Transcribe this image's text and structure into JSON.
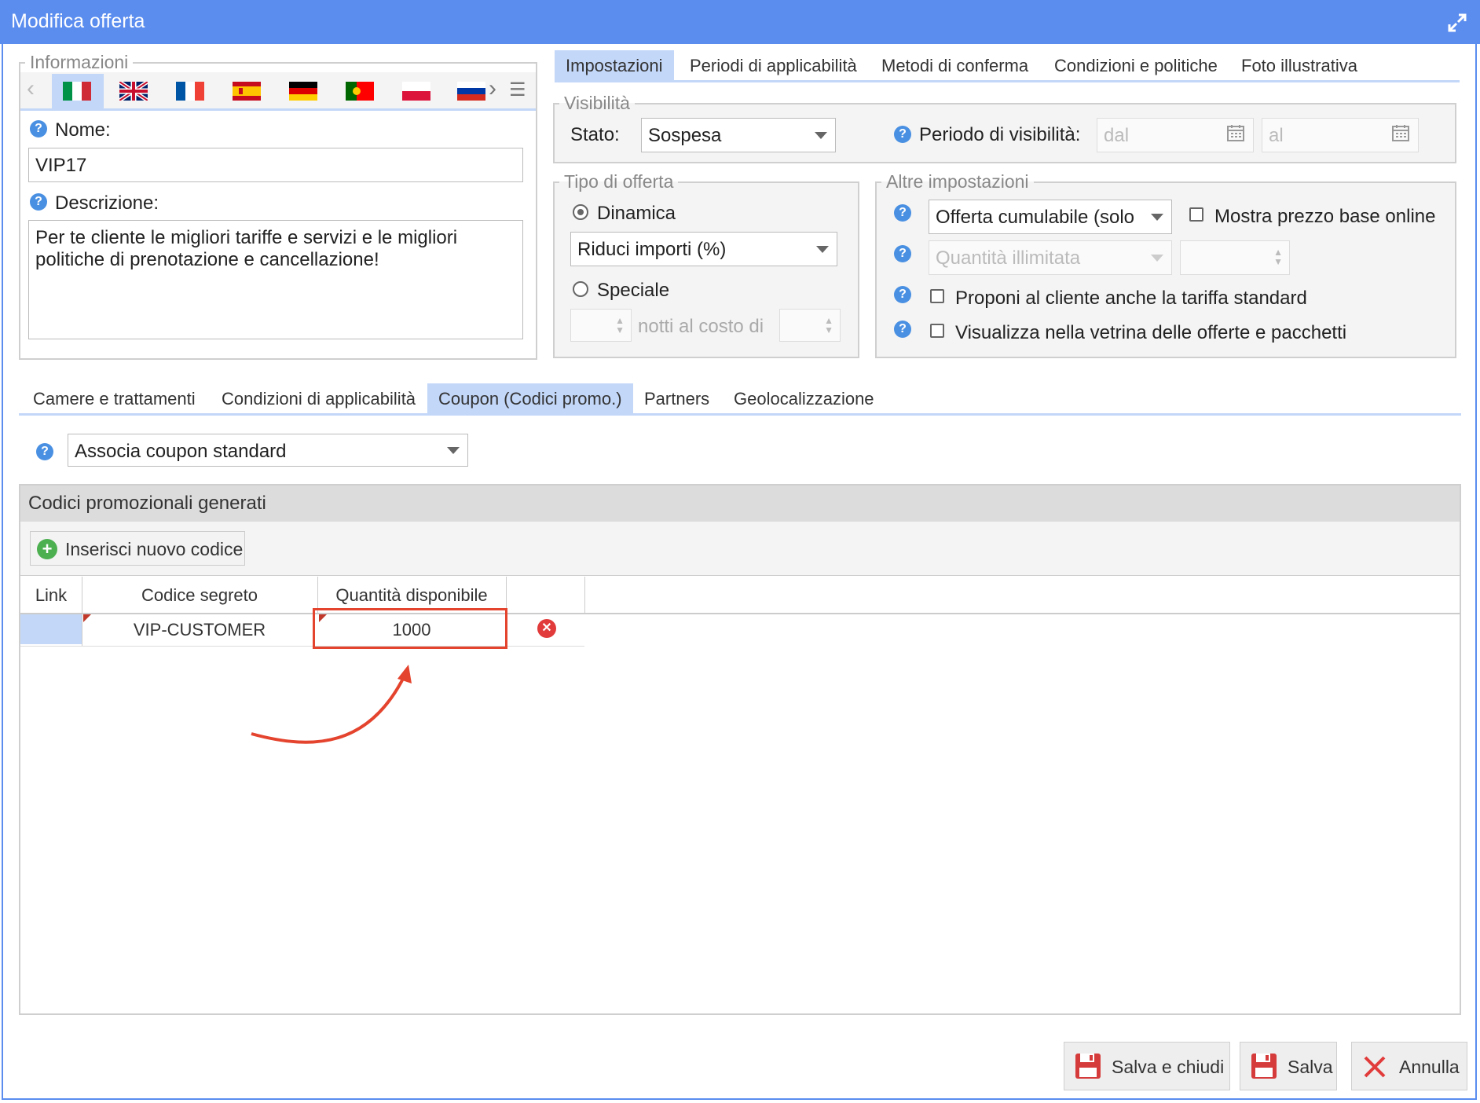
{
  "window": {
    "title": "Modifica offerta",
    "accent": "#5b8def"
  },
  "info": {
    "legend": "Informazioni",
    "languages": [
      "it",
      "en",
      "fr",
      "es",
      "de",
      "pt",
      "pl",
      "ru"
    ],
    "name_label": "Nome:",
    "name_value": "VIP17",
    "desc_label": "Descrizione:",
    "desc_value": "Per te cliente le migliori tariffe e servizi e le migliori politiche di prenotazione e cancellazione!"
  },
  "top_tabs": [
    "Impostazioni",
    "Periodi di applicabilità",
    "Metodi di conferma",
    "Condizioni e politiche",
    "Foto illustrativa"
  ],
  "visibility": {
    "legend": "Visibilità",
    "stato_label": "Stato:",
    "stato_value": "Sospesa",
    "period_label": "Periodo di visibilità:",
    "from_placeholder": "dal",
    "to_placeholder": "al"
  },
  "offer_type": {
    "legend": "Tipo di offerta",
    "dynamic_label": "Dinamica",
    "dynamic_select": "Riduci importi (%)",
    "special_label": "Speciale",
    "nights_text": "notti al costo di"
  },
  "other": {
    "legend": "Altre impostazioni",
    "cumulative_select": "Offerta cumulabile (solo",
    "show_base_price": "Mostra prezzo base online",
    "quantity_select": "Quantità illimitata",
    "propose_standard": "Proponi al cliente anche la tariffa standard",
    "show_showcase": "Visualizza nella vetrina delle offerte e pacchetti"
  },
  "bottom_tabs": [
    "Camere e trattamenti",
    "Condizioni di applicabilità",
    "Coupon (Codici promo.)",
    "Partners",
    "Geolocalizzazione"
  ],
  "coupon": {
    "associate_select": "Associa coupon standard",
    "panel_title": "Codici promozionali generati",
    "insert_button": "Inserisci nuovo codice",
    "columns": [
      "Link",
      "Codice segreto",
      "Quantità disponibile"
    ],
    "rows": [
      {
        "code": "VIP-CUSTOMER",
        "quantity": "1000"
      }
    ]
  },
  "footer": {
    "save_close": "Salva e chiudi",
    "save": "Salva",
    "cancel": "Annulla"
  }
}
